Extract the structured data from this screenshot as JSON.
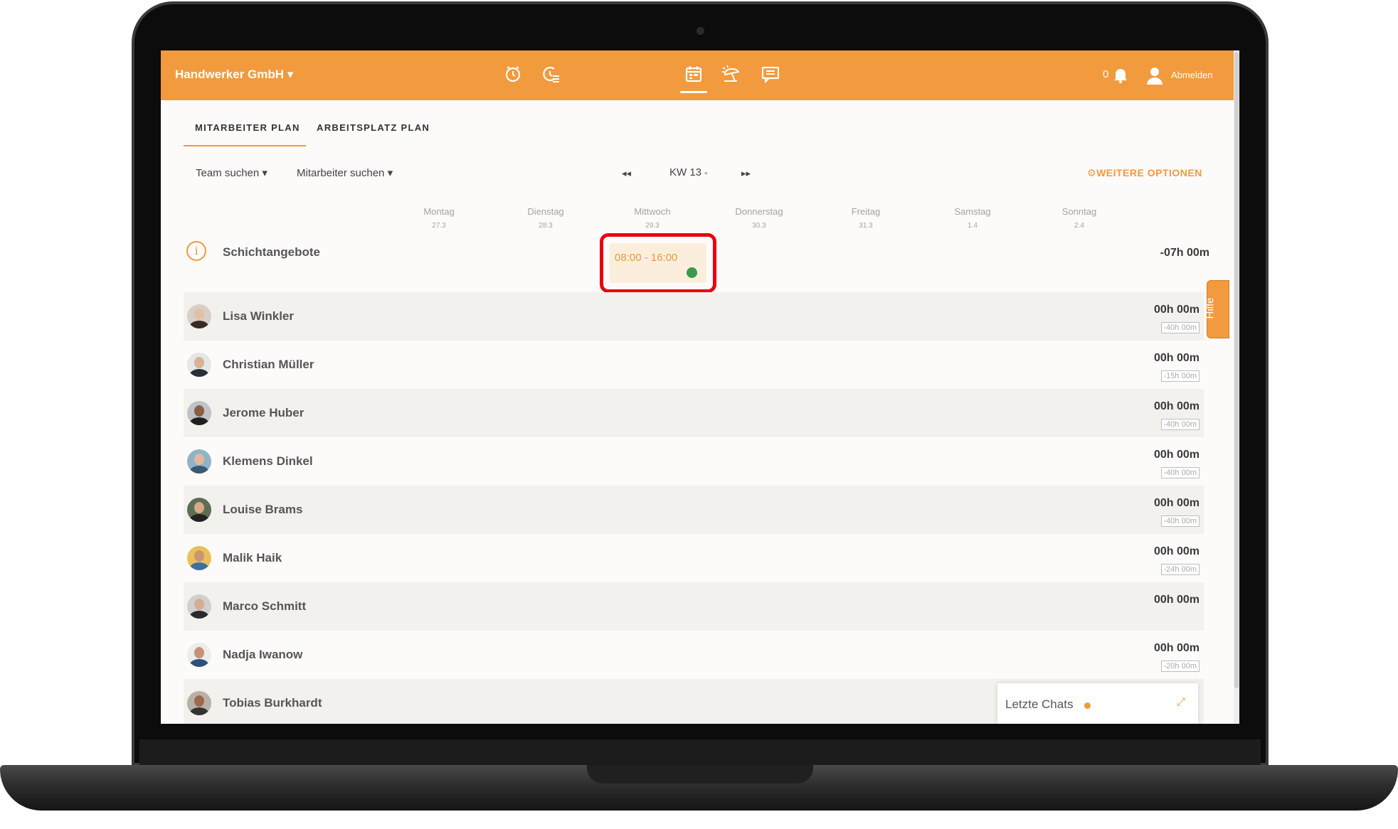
{
  "header": {
    "company": "Handwerker GmbH ▾",
    "nav_icons": [
      "clock-icon",
      "timesheet-icon",
      "calendar-icon",
      "vacation-icon",
      "chat-icon"
    ],
    "notifications_count": "0",
    "logout": "Abmelden",
    "accent_color": "#f19a3e"
  },
  "tabs": [
    "MITARBEITER PLAN",
    "ARBEITSPLATZ PLAN"
  ],
  "filters": {
    "team": "Team suchen",
    "employee": "Mitarbeiter suchen"
  },
  "week": {
    "prev": "◂◂",
    "label": "KW 13",
    "next": "▸▸"
  },
  "options": "WEITERE OPTIONEN",
  "days": [
    {
      "name": "Montag",
      "date": "27.3"
    },
    {
      "name": "Dienstag",
      "date": "28.3"
    },
    {
      "name": "Mittwoch",
      "date": "29.3"
    },
    {
      "name": "Donnerstag",
      "date": "30.3"
    },
    {
      "name": "Freitag",
      "date": "31.3"
    },
    {
      "name": "Samstag",
      "date": "1.4"
    },
    {
      "name": "Sonntag",
      "date": "2.4"
    }
  ],
  "shift_offers": {
    "title": "Schichtangebote",
    "total": "-07h 00m",
    "shift_time": "08:00 - 16:00"
  },
  "employees": [
    {
      "name": "Lisa Winkler",
      "total": "00h 00m",
      "target": "-40h 00m"
    },
    {
      "name": "Christian Müller",
      "total": "00h 00m",
      "target": "-15h 00m"
    },
    {
      "name": "Jerome Huber",
      "total": "00h 00m",
      "target": "-40h 00m"
    },
    {
      "name": "Klemens Dinkel",
      "total": "00h 00m",
      "target": "-40h 00m"
    },
    {
      "name": "Louise Brams",
      "total": "00h 00m",
      "target": "-40h 00m"
    },
    {
      "name": "Malik Haik",
      "total": "00h 00m",
      "target": "-24h 00m"
    },
    {
      "name": "Marco Schmitt",
      "total": "00h 00m",
      "target": ""
    },
    {
      "name": "Nadja Iwanow",
      "total": "00h 00m",
      "target": "-20h 00m"
    },
    {
      "name": "Tobias Burkhardt",
      "total": "",
      "target": ""
    }
  ],
  "help": "Hilfe",
  "chat": {
    "title": "Letzte Chats"
  }
}
